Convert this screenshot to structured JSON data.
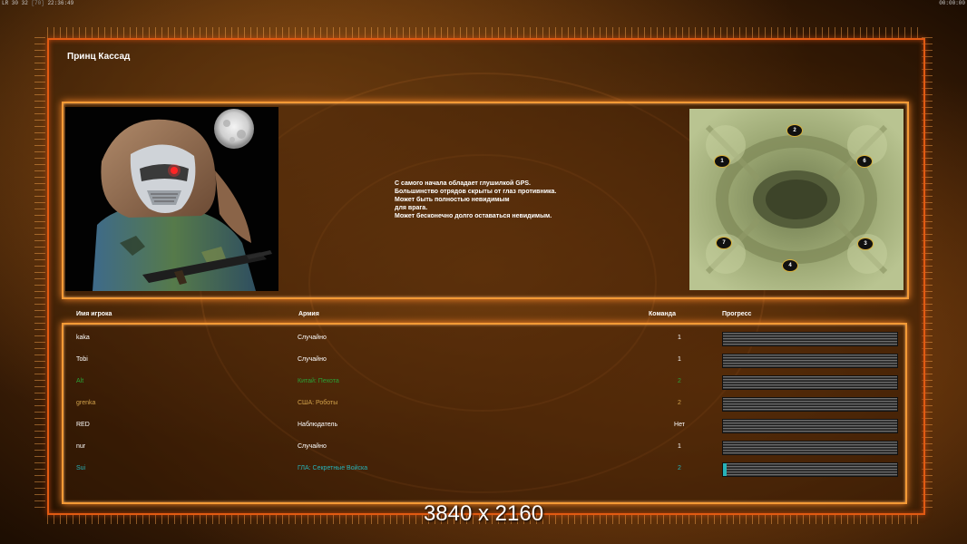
{
  "status_bar": {
    "left_a": "LR 30 32",
    "left_b": "[70]",
    "left_time": "22:36:49",
    "right_time": "00:00:00"
  },
  "title": "Принц Кассад",
  "description": [
    "С самого начала обладает глушилкой GPS.",
    "Большинство отрядов скрыты от глаз противника.",
    "Может быть полностью невидимым",
    "для врага.",
    "Может бесконечно долго оставаться невидимым."
  ],
  "map_positions": [
    "1",
    "2",
    "6",
    "7",
    "4",
    "3"
  ],
  "table": {
    "headers": {
      "name": "Имя игрока",
      "army": "Армия",
      "team": "Команда",
      "progress": "Прогресс"
    },
    "rows": [
      {
        "name": "kaka",
        "army": "Случайно",
        "team": "1",
        "color": "#ffffff",
        "progress": 0
      },
      {
        "name": "Tobi",
        "army": "Случайно",
        "team": "1",
        "color": "#ffffff",
        "progress": 0
      },
      {
        "name": "Alt",
        "army": "Китай: Пехота",
        "team": "2",
        "color": "#2aa336",
        "progress": 0
      },
      {
        "name": "grenka",
        "army": "США: Роботы",
        "team": "2",
        "color": "#d0a14a",
        "progress": 0
      },
      {
        "name": "RED",
        "army": "Наблюдатель",
        "team": "Нет",
        "color": "#ffffff",
        "progress": 0
      },
      {
        "name": "nur",
        "army": "Случайно",
        "team": "1",
        "color": "#ffffff",
        "progress": 0
      },
      {
        "name": "Sui",
        "army": "ГЛА: Секретные Войска",
        "team": "2",
        "color": "#27b2b8",
        "progress": 0.02
      }
    ]
  },
  "accent_color": "#f39a36",
  "progress_fill_color": "#27b2b8",
  "overlay_text": "3840 x 2160"
}
